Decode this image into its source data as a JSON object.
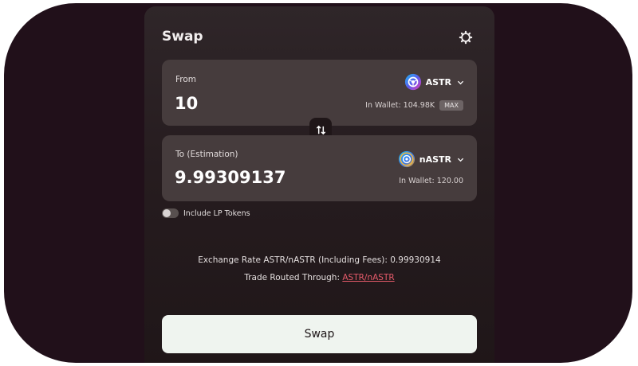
{
  "header": {
    "title": "Swap",
    "settings_icon": "gear-icon"
  },
  "from": {
    "label": "From",
    "amount": "10",
    "token": "ASTR",
    "wallet_text": "In Wallet: 104.98K",
    "max_label": "MAX"
  },
  "to": {
    "label": "To (Estimation)",
    "amount": "9.99309137",
    "token": "nASTR",
    "wallet_text": "In Wallet: 120.00"
  },
  "swap_direction_icon": "swap-arrows-icon",
  "lp_toggle": {
    "label": "Include LP Tokens",
    "enabled": false
  },
  "info": {
    "rate_text": "Exchange Rate ASTR/nASTR (Including Fees): 0.99930914",
    "route_prefix": "Trade Routed Through: ",
    "route_link": "ASTR/nASTR"
  },
  "action": {
    "swap_label": "Swap"
  },
  "colors": {
    "frame": "#21101a",
    "card": "#463c3d",
    "link": "#e45a6a",
    "button": "#eff4ef"
  }
}
